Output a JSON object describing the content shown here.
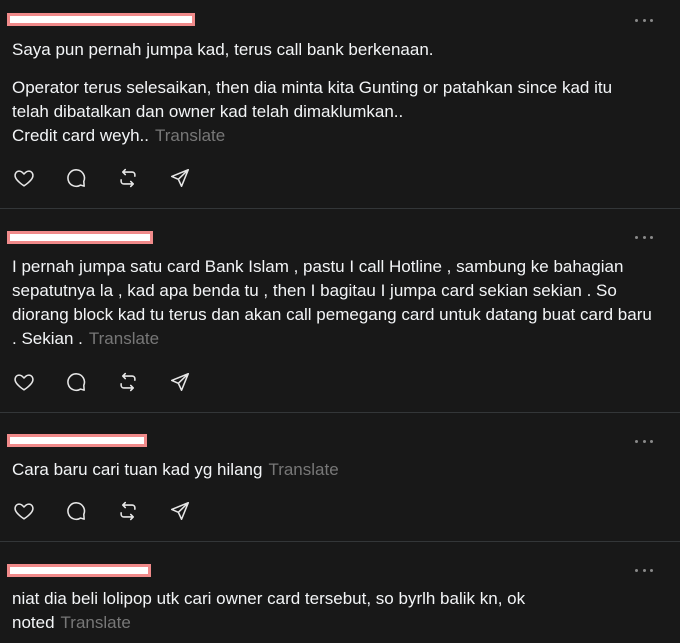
{
  "posts": [
    {
      "paragraphs": [
        "Saya pun pernah jumpa kad, terus call bank berkenaan.",
        "Operator terus selesaikan, then dia minta kita Gunting or patahkan since kad itu telah dibatalkan dan owner kad telah dimaklumkan..\nCredit card weyh.."
      ],
      "translate_label": "Translate"
    },
    {
      "paragraphs": [
        "I pernah jumpa satu card Bank Islam , pastu I call Hotline , sambung ke bahagian sepatutnya la , kad apa benda tu , then I bagitau I jumpa card sekian sekian . So diorang block kad tu terus dan akan call pemegang card untuk datang buat card baru . Sekian ."
      ],
      "translate_label": "Translate"
    },
    {
      "paragraphs": [
        "Cara baru cari tuan kad yg hilang"
      ],
      "translate_label": "Translate"
    },
    {
      "paragraphs": [
        "niat dia beli lolipop utk cari owner card tersebut, so byrlh balik kn, ok noted"
      ],
      "translate_label": "Translate"
    }
  ],
  "icons": {
    "like": "heart-icon",
    "reply": "comment-icon",
    "repost": "repost-icon",
    "share": "send-icon",
    "more": "more-horizontal-icon"
  },
  "colors": {
    "background": "#181818",
    "text": "#f3f5f7",
    "muted": "#777777",
    "divider": "#333638",
    "redaction_border": "#f08a8a"
  }
}
